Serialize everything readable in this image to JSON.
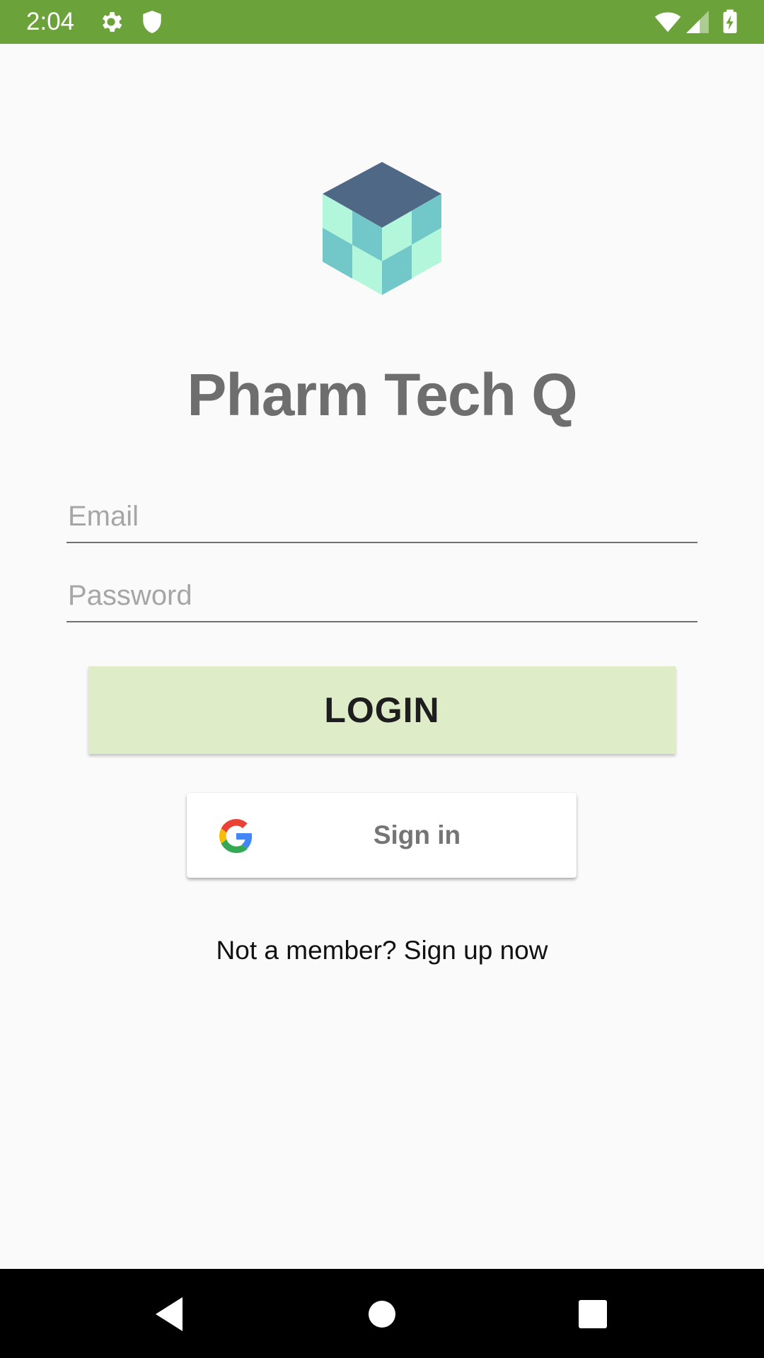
{
  "status_bar": {
    "time": "2:04",
    "background_color": "#6ba23a",
    "icons": [
      "settings-icon",
      "shield-icon",
      "wifi-icon",
      "signal-icon",
      "battery-charging-icon"
    ]
  },
  "app": {
    "title": "Pharm Tech Q",
    "logo_icon": "cube-logo-icon"
  },
  "form": {
    "email_placeholder": "Email",
    "email_value": "",
    "password_placeholder": "Password",
    "password_value": "",
    "login_label": "LOGIN",
    "login_button_color": "#deecc8"
  },
  "google": {
    "label": "Sign in",
    "icon": "google-g-icon"
  },
  "signup": {
    "text": "Not a member? Sign up now"
  },
  "nav_bar": {
    "buttons": [
      "back-icon",
      "home-icon",
      "recents-icon"
    ]
  }
}
